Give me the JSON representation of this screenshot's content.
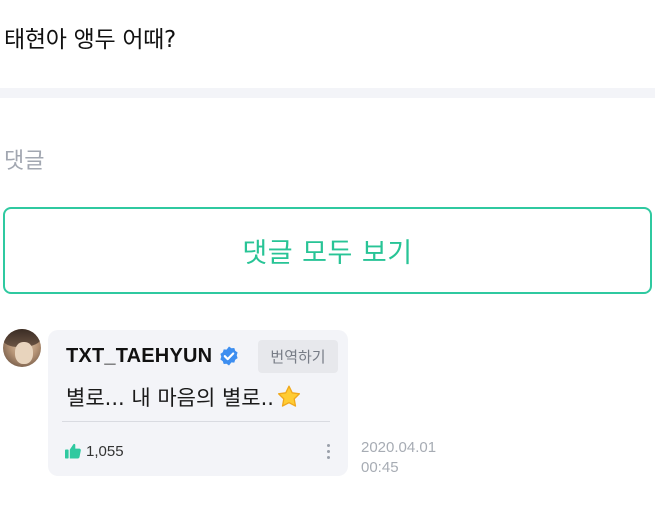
{
  "post": {
    "question": "태현아 앵두 어때?"
  },
  "comments_section": {
    "title": "댓글",
    "view_all_label": "댓글 모두 보기",
    "accent_color": "#2fc9a0"
  },
  "comment": {
    "author": "TXT_TAEHYUN",
    "verified": true,
    "verified_icon": "verified-badge-icon",
    "translate_label": "번역하기",
    "text": "별로... 내 마음의 별로..",
    "emoji_icon": "star-icon",
    "likes": "1,055",
    "like_icon": "thumbs-up-icon",
    "like_color": "#2fc9a0",
    "date": "2020.04.01",
    "time": "00:45"
  }
}
